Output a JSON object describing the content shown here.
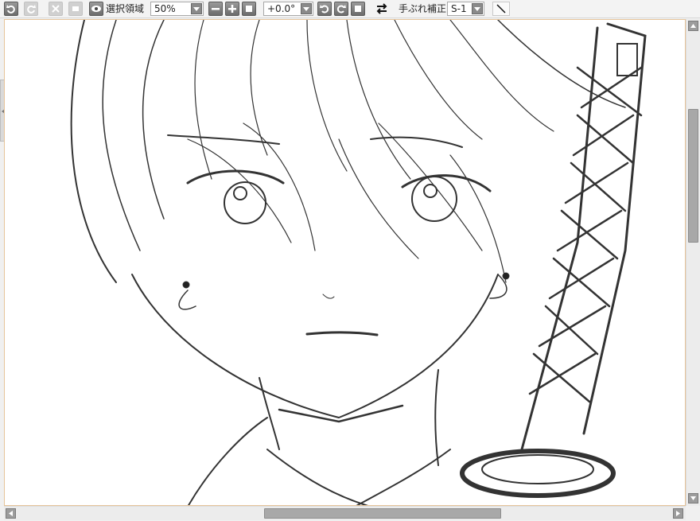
{
  "toolbar": {
    "undo_icon": "undo-icon",
    "redo_icon": "redo-icon",
    "cut_icon": "cut-icon",
    "clear_icon": "clear-icon",
    "selection_view_label": "選択領域",
    "zoom_value": "50%",
    "rotation_value": "+0.0°",
    "stabilizer_label": "手ぶれ補正",
    "stabilizer_value": "S-1"
  },
  "canvas": {
    "content": "manga sketch of character with sword",
    "background": "#ffffff",
    "frame_color": "#e6c49a"
  },
  "colors": {
    "toolbar_bg": "#f3f3f3",
    "button_dark": "#7a7a7a",
    "scrollbar_bg": "#ececec",
    "thumb": "#a8a8a8"
  }
}
